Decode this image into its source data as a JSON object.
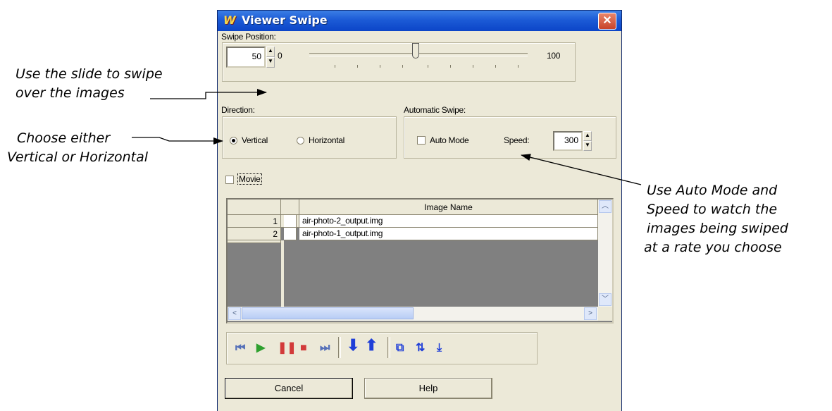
{
  "annotations": {
    "slide": [
      "Use the slide to swipe",
      "over the images"
    ],
    "direction": [
      "Choose either",
      "Vertical or Horizontal"
    ],
    "auto": [
      "Use Auto Mode and",
      "Speed to watch the",
      "images being swiped",
      "at a rate you choose"
    ]
  },
  "window": {
    "title": "Viewer Swipe",
    "close_glyph": "✕"
  },
  "swipe_position": {
    "label": "Swipe Position:",
    "value": "50",
    "min_label": "0",
    "max_label": "100",
    "slider_value": 50
  },
  "direction": {
    "label": "Direction:",
    "options": [
      "Vertical",
      "Horizontal"
    ],
    "selected": "Vertical"
  },
  "automatic_swipe": {
    "label": "Automatic Swipe:",
    "auto_mode_label": "Auto Mode",
    "auto_mode_checked": false,
    "speed_label": "Speed:",
    "speed_value": "300"
  },
  "movie": {
    "label": "Movie",
    "checked": false
  },
  "table": {
    "column_header": "Image Name",
    "rows": [
      {
        "index": "1",
        "name": "air-photo-2_output.img"
      },
      {
        "index": "2",
        "name": "air-photo-1_output.img"
      }
    ]
  },
  "toolbar_icons": [
    "first-frame-icon",
    "play-icon",
    "pause-icon",
    "stop-icon",
    "last-frame-icon",
    "move-down-icon",
    "move-up-icon",
    "reset-order-icon",
    "swap-order-icon",
    "move-bottom-icon"
  ],
  "buttons": {
    "cancel": "Cancel",
    "help": "Help"
  },
  "colors": {
    "titlebar": "#0c45c8",
    "dialog_bg": "#ece9d8",
    "play_green": "#2ea02e",
    "pause_red": "#d23a3a",
    "arrow_blue": "#1f3fd8"
  }
}
